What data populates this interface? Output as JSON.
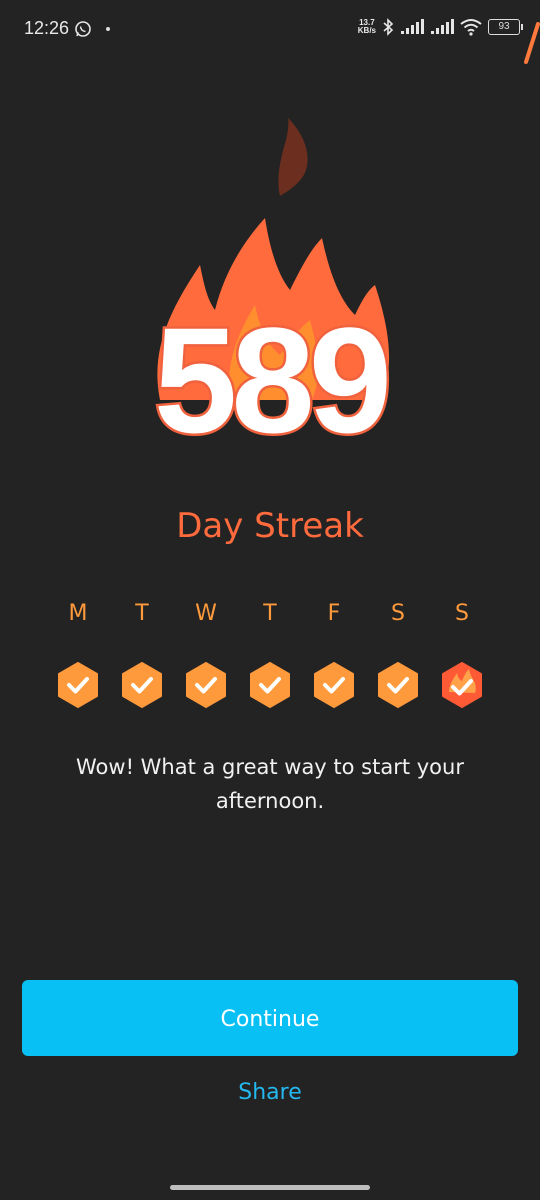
{
  "status_bar": {
    "time": "12:26",
    "net_speed_value": "13.7",
    "net_speed_unit": "KB/s",
    "battery": "93",
    "icons": [
      "whatsapp-icon",
      "bluetooth-icon",
      "signal-icon",
      "signal-icon",
      "wifi-icon",
      "battery-icon"
    ]
  },
  "streak": {
    "number": "589",
    "label": "Day Streak"
  },
  "week": {
    "days": [
      {
        "letter": "M",
        "status": "done"
      },
      {
        "letter": "T",
        "status": "done"
      },
      {
        "letter": "W",
        "status": "done"
      },
      {
        "letter": "T",
        "status": "done"
      },
      {
        "letter": "F",
        "status": "done"
      },
      {
        "letter": "S",
        "status": "done"
      },
      {
        "letter": "S",
        "status": "today"
      }
    ]
  },
  "message": "Wow! What a great way to start your afternoon.",
  "actions": {
    "continue_label": "Continue",
    "share_label": "Share"
  },
  "colors": {
    "background": "#232323",
    "accent_orange": "#ff6b3d",
    "badge_orange": "#ff9a3c",
    "continue_blue": "#08c0f3",
    "share_blue": "#24b8ef"
  }
}
